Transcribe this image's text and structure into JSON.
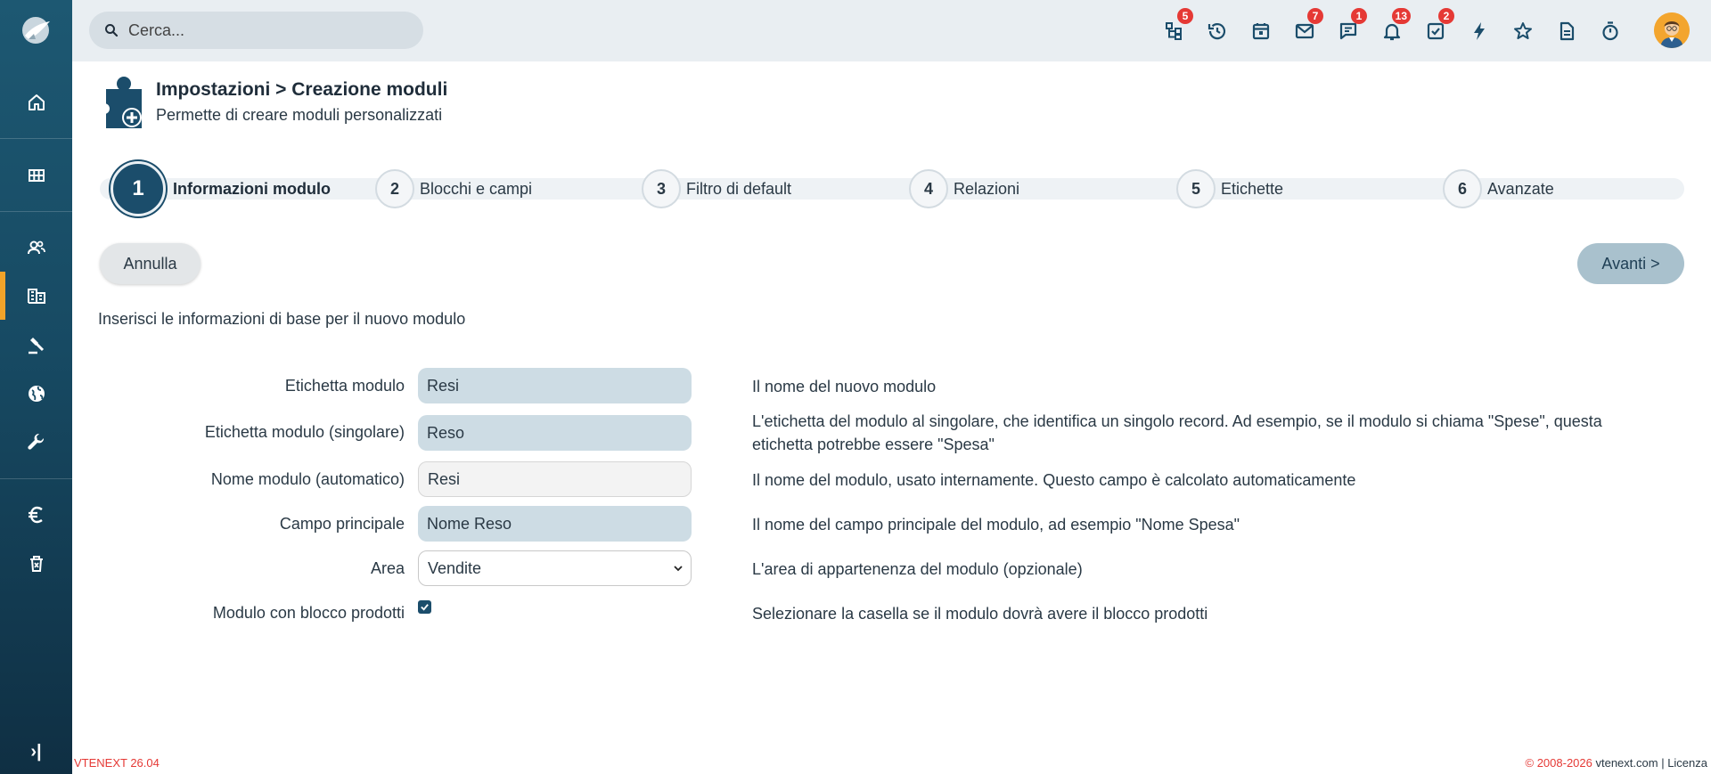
{
  "app": {
    "version": "VTENEXT 26.04"
  },
  "topbar": {
    "search_placeholder": "Cerca...",
    "icons": [
      {
        "name": "processes-icon",
        "badge": "5"
      },
      {
        "name": "history-icon",
        "badge": ""
      },
      {
        "name": "calendar-icon",
        "badge": ""
      },
      {
        "name": "mail-icon",
        "badge": "7"
      },
      {
        "name": "chat-icon",
        "badge": "1"
      },
      {
        "name": "bell-icon",
        "badge": "13"
      },
      {
        "name": "tasks-icon",
        "badge": "2"
      },
      {
        "name": "lightning-icon",
        "badge": ""
      },
      {
        "name": "star-icon",
        "badge": ""
      },
      {
        "name": "document-icon",
        "badge": ""
      },
      {
        "name": "timer-icon",
        "badge": ""
      }
    ]
  },
  "header": {
    "title": "Impostazioni > Creazione moduli",
    "subtitle": "Permette di creare moduli personalizzati"
  },
  "steps": [
    {
      "num": "1",
      "label": "Informazioni modulo"
    },
    {
      "num": "2",
      "label": "Blocchi e campi"
    },
    {
      "num": "3",
      "label": "Filtro di default"
    },
    {
      "num": "4",
      "label": "Relazioni"
    },
    {
      "num": "5",
      "label": "Etichette"
    },
    {
      "num": "6",
      "label": "Avanzate"
    }
  ],
  "buttons": {
    "cancel": "Annulla",
    "next": "Avanti >"
  },
  "intro": "Inserisci le informazioni di base per il nuovo modulo",
  "form": {
    "module_label": {
      "label": "Etichetta modulo",
      "value": "Resi",
      "desc": "Il nome del nuovo modulo"
    },
    "module_label_singular": {
      "label": "Etichetta modulo (singolare)",
      "value": "Reso",
      "desc": "L'etichetta del modulo al singolare, che identifica un singolo record. Ad esempio, se il modulo si chiama \"Spese\", questa etichetta potrebbe essere \"Spesa\""
    },
    "module_name": {
      "label": "Nome modulo (automatico)",
      "value": "Resi",
      "desc": "Il nome del modulo, usato internamente. Questo campo è calcolato automaticamente"
    },
    "main_field": {
      "label": "Campo principale",
      "value": "Nome Reso",
      "desc": "Il nome del campo principale del modulo, ad esempio \"Nome Spesa\""
    },
    "area": {
      "label": "Area",
      "value": "Vendite",
      "desc": "L'area di appartenenza del modulo (opzionale)"
    },
    "product_block": {
      "label": "Modulo con blocco prodotti",
      "checked": true,
      "desc": "Selezionare la casella se il modulo dovrà avere il blocco prodotti"
    }
  },
  "footer": {
    "copyright": "© 2008-2026",
    "site": "vtenext.com",
    "license": "Licenza"
  },
  "colors": {
    "accent": "#1b4d6b",
    "sidebar": "#174a63",
    "active_marker": "#f0a32a",
    "badge": "#e53935"
  }
}
